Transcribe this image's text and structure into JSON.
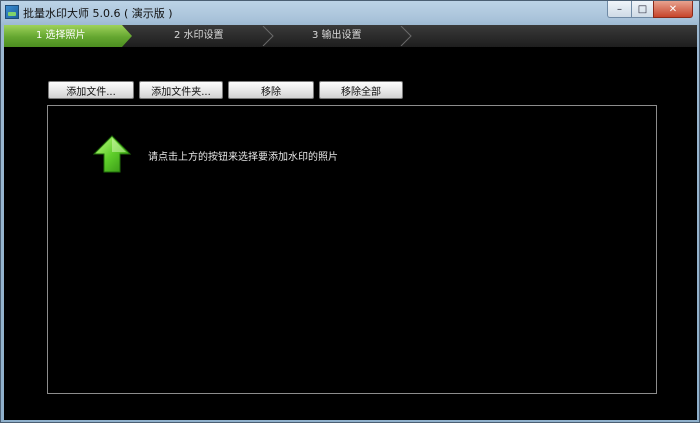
{
  "window": {
    "title": "批量水印大师 5.0.6 ( 演示版 )",
    "controls": {
      "minimize": "–",
      "maximize": "□",
      "close": "✕"
    }
  },
  "steps": [
    {
      "label": "1 选择照片",
      "active": true
    },
    {
      "label": "2 水印设置",
      "active": false
    },
    {
      "label": "3 输出设置",
      "active": false
    }
  ],
  "toolbar": {
    "add_file": "添加文件...",
    "add_folder": "添加文件夹...",
    "remove": "移除",
    "remove_all": "移除全部"
  },
  "list": {
    "hint": "请点击上方的按钮来选择要添加水印的照片",
    "hint_icon": "green-up-arrow-icon"
  },
  "colors": {
    "accent_green": "#64a630",
    "background": "#000000"
  }
}
